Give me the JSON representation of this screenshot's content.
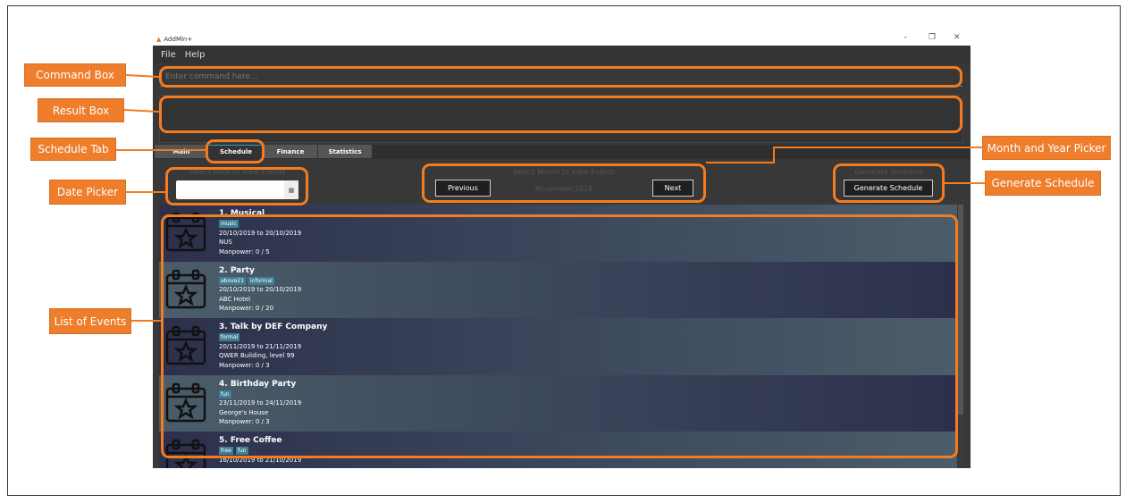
{
  "window": {
    "title": "AddMin+",
    "controls": [
      "–",
      "❐",
      "✕"
    ]
  },
  "menu": [
    "File",
    "Help"
  ],
  "command": {
    "placeholder": "Enter command here..."
  },
  "result": "",
  "tabs": [
    "Main",
    "Schedule",
    "Finance",
    "Statistics"
  ],
  "date_picker": {
    "label": "Select Date to View Events",
    "value": ""
  },
  "month_picker": {
    "label": "Select Month to View Events",
    "previous": "Previous",
    "current": "November,2019",
    "next": "Next"
  },
  "generate": {
    "label": "Generate Schedule",
    "button": "Generate Schedule"
  },
  "events": [
    {
      "title": "1.  Musical",
      "tags": [
        "music"
      ],
      "dates": "20/10/2019 to 20/10/2019",
      "venue": "NUS",
      "manpower": "Manpower: 0 / 5"
    },
    {
      "title": "2.  Party",
      "tags": [
        "above21",
        "informal"
      ],
      "dates": "20/10/2019 to 20/10/2019",
      "venue": "ABC Hotel",
      "manpower": "Manpower: 0 / 20"
    },
    {
      "title": "3.  Talk by DEF Company",
      "tags": [
        "formal"
      ],
      "dates": "20/11/2019 to 21/11/2019",
      "venue": "QWER Building, level 99",
      "manpower": "Manpower: 0 / 3"
    },
    {
      "title": "4.  Birthday Party",
      "tags": [
        "fun"
      ],
      "dates": "23/11/2019 to 24/11/2019",
      "venue": "George's House",
      "manpower": "Manpower: 0 / 3"
    },
    {
      "title": "5.  Free Coffee",
      "tags": [
        "free",
        "fun"
      ],
      "dates": "16/10/2019 to 21/10/2019",
      "venue": "",
      "manpower": ""
    }
  ],
  "callouts": {
    "command_box": "Command Box",
    "result_box": "Result Box",
    "schedule_tab": "Schedule Tab",
    "date_picker": "Date Picker",
    "list_of_events": "List of Events",
    "month_year_picker": "Month and Year Picker",
    "generate_schedule": "Generate Schedule"
  },
  "colors": {
    "accent": "#f47c20",
    "background": "#383838"
  }
}
